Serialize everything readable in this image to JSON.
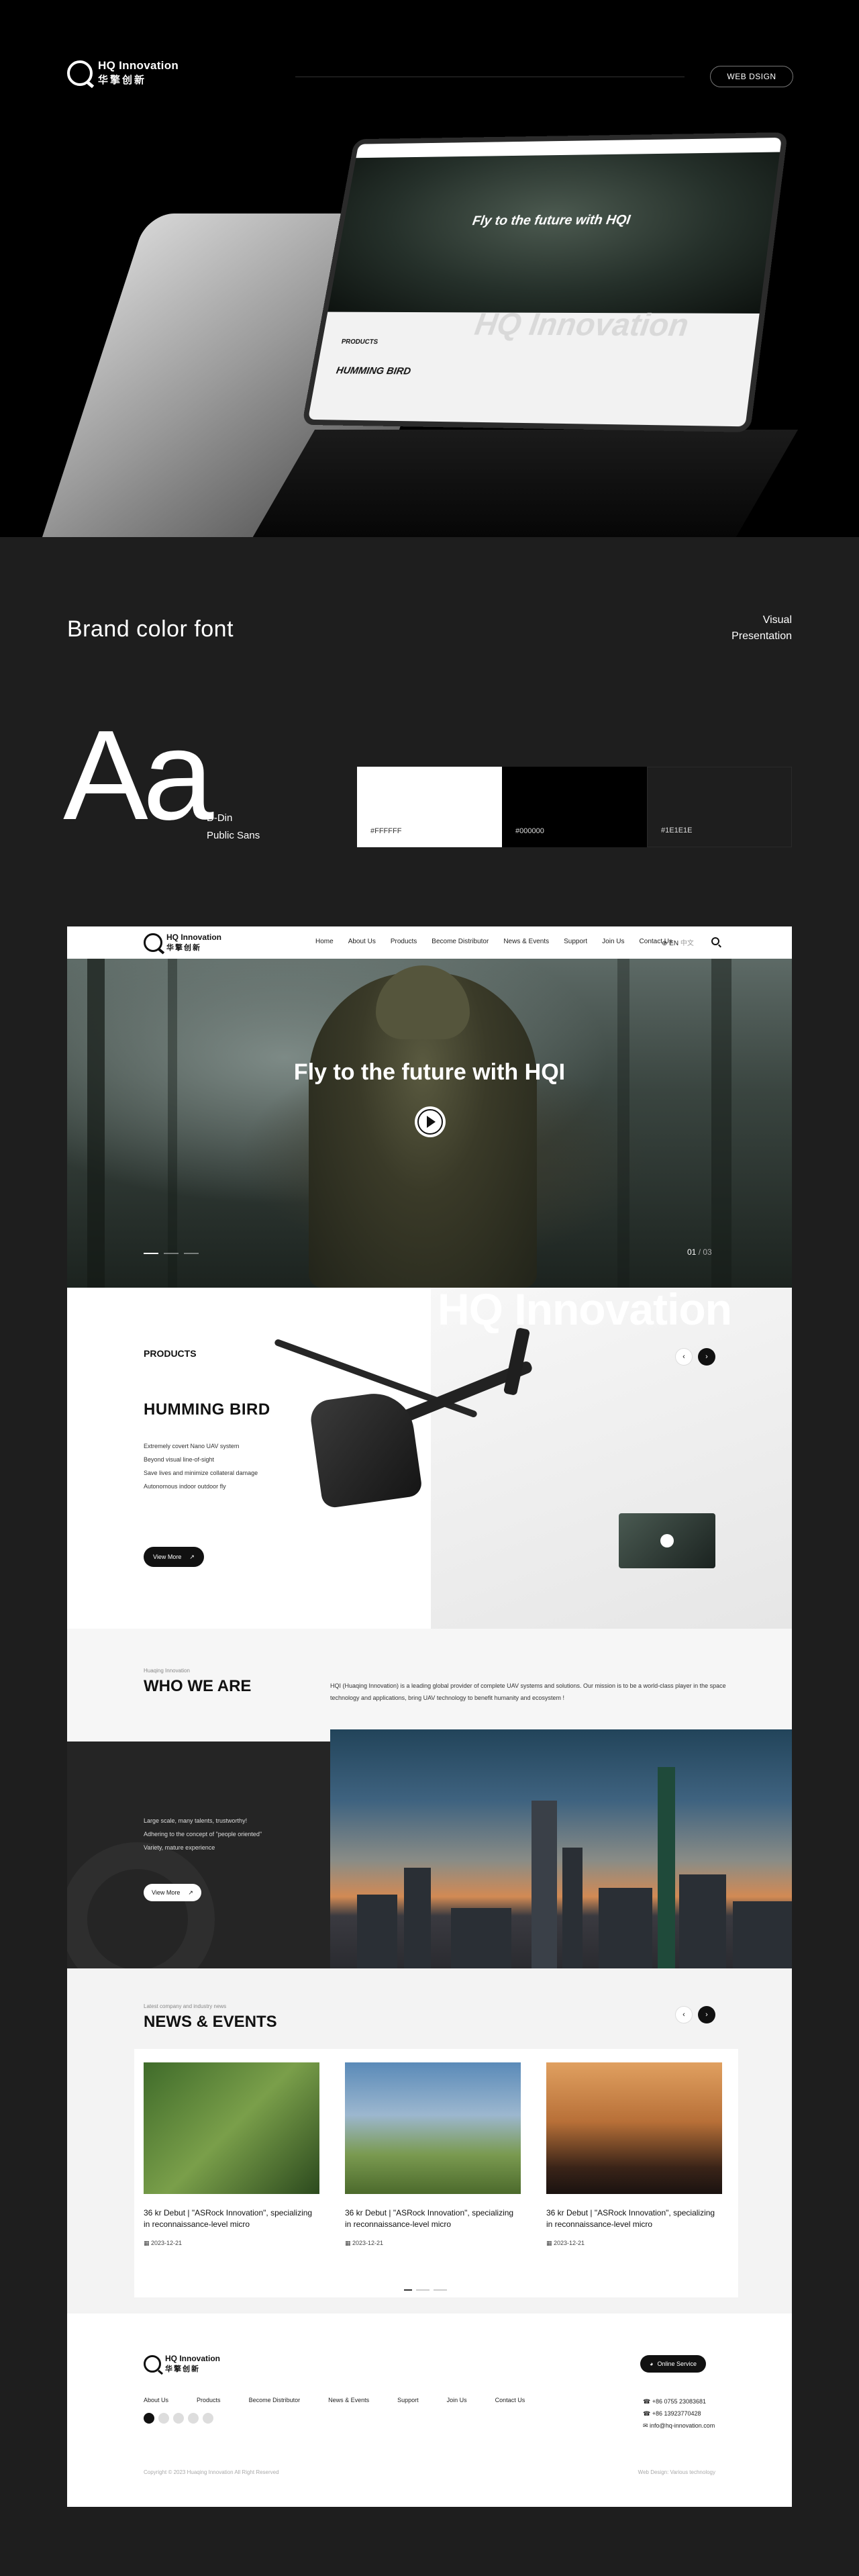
{
  "brand": {
    "name": "HQ Innovation",
    "name_cn": "华擎创新"
  },
  "header": {
    "pill": "WEB DSIGN"
  },
  "laptop": {
    "hero_title": "Fly to the future with HQI",
    "products_label": "PRODUCTS",
    "product_name": "HUMMING BIRD",
    "watermark": "HQ Innovation"
  },
  "brand_section": {
    "title": "Brand color font",
    "visual_line1": "Visual",
    "visual_line2": "Presentation",
    "aa": "Aa",
    "font1": "D-Din",
    "font2": "Public Sans"
  },
  "swatches": [
    {
      "label": "#FFFFFF",
      "color": "#FFFFFF"
    },
    {
      "label": "#000000",
      "color": "#000000"
    },
    {
      "label": "#1E1E1E",
      "color": "#1E1E1E"
    }
  ],
  "site": {
    "nav": {
      "items": [
        "Home",
        "About Us",
        "Products",
        "Become Distributor",
        "News & Events",
        "Support",
        "Join Us",
        "Contact Us"
      ],
      "lang_en": "EN",
      "lang_cn": "中文"
    },
    "hero": {
      "title": "Fly to the future with HQI",
      "count_current": "01",
      "count_total": "/ 03"
    },
    "products": {
      "watermark": "HQ Innovation",
      "label": "PRODUCTS",
      "name": "HUMMING BIRD",
      "features": [
        "Extremely covert Nano UAV system",
        "Beyond visual line-of-sight",
        "Save lives and minimize collateral damage",
        "Autonomous indoor outdoor fly"
      ],
      "button": "View More"
    },
    "who": {
      "small": "Huaqing Innovation",
      "title": "WHO WE ARE",
      "text": "HQI (Huaqing Innovation) is a leading global provider of complete UAV systems and solutions. Our mission is to be a world-class player in the space technology and applications, bring UAV technology to benefit humanity and ecosystem !",
      "points": [
        "Large scale, many talents, trustworthy!",
        "Adhering to the concept of \"people oriented\"",
        "Variety, mature experience"
      ],
      "button": "View More"
    },
    "news": {
      "small": "Latest company and industry news",
      "title": "NEWS & EVENTS",
      "cards": [
        {
          "title": "36 kr Debut | \"ASRock Innovation\", specializing in reconnaissance-level micro",
          "date": "2023-12-21"
        },
        {
          "title": "36 kr Debut | \"ASRock Innovation\", specializing in reconnaissance-level micro",
          "date": "2023-12-21"
        },
        {
          "title": "36 kr Debut | \"ASRock Innovation\", specializing in reconnaissance-level micro",
          "date": "2023-12-21"
        }
      ]
    },
    "footer": {
      "links": [
        "About Us",
        "Products",
        "Become Distributor",
        "News & Events",
        "Support",
        "Join Us",
        "Contact Us"
      ],
      "service": "Online Service",
      "phone1": "+86 0755 23083681",
      "phone2": "+86 13923770428",
      "email": "info@hq-innovation.com",
      "copyright": "Copyright © 2023 Huaqing Innovation All Right Reserved",
      "credit": "Web Design: Various technology"
    }
  }
}
